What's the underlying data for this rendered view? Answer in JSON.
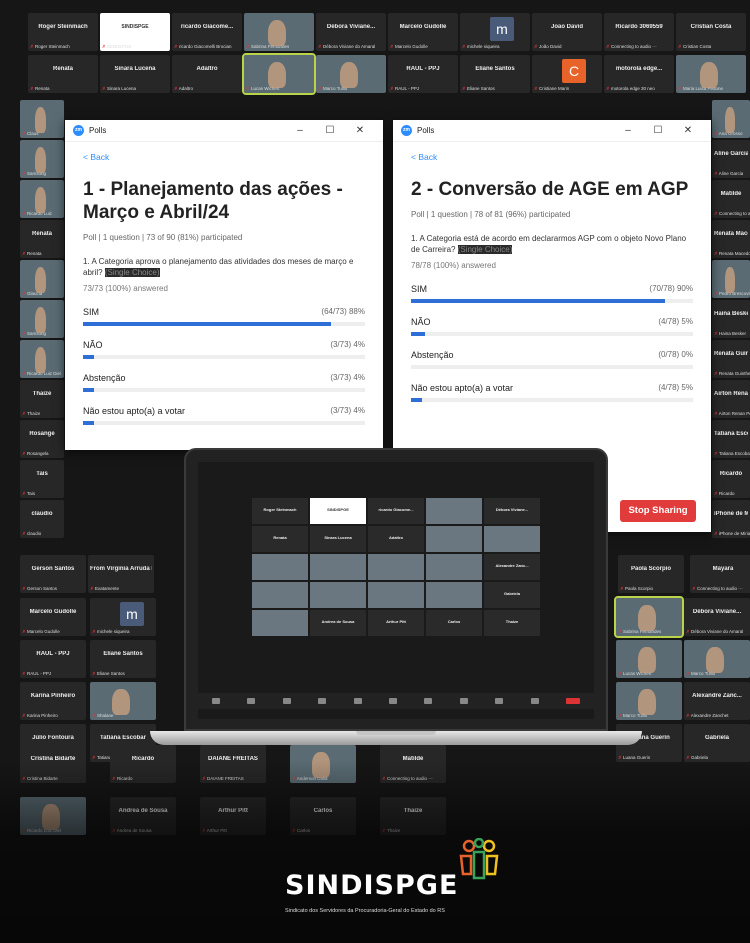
{
  "background": {
    "row1": [
      {
        "name": "Roger Steinmach",
        "label": "Roger Steinmach"
      },
      {
        "name": "SINDISPGE",
        "label": "SINDISPGE",
        "logo": true
      },
      {
        "name": "ricardo Giacome...",
        "label": "ricardo Giacomelli Brocian"
      },
      {
        "name": "",
        "label": "Sabrina Fernandes",
        "photo": true
      },
      {
        "name": "Débora Viviane...",
        "label": "Débora Viviane do Amaral"
      },
      {
        "name": "Marcelo Gudolle",
        "label": "Marcelo Gudolle"
      },
      {
        "name": "",
        "label": "michele siqueira",
        "avatar": "m"
      },
      {
        "name": "João David",
        "label": "João David"
      },
      {
        "name": "Ricardo 3069559",
        "label": "Connecting to audio ···"
      },
      {
        "name": "Cristian Costa",
        "label": "Cristian Costa"
      }
    ],
    "row2": [
      {
        "name": "Renata",
        "label": "Renata"
      },
      {
        "name": "Sinara Lucena",
        "label": "Sinara Lucena"
      },
      {
        "name": "Adaltro",
        "label": "Adaltro"
      },
      {
        "name": "",
        "label": "Lucas Wichert",
        "photo": true,
        "hl": true
      },
      {
        "name": "",
        "label": "Marco Tullio",
        "photo": true
      },
      {
        "name": "RAUL - PPJ",
        "label": "RAUL - PPJ"
      },
      {
        "name": "Eliane Santos",
        "label": "Eliane Santos"
      },
      {
        "name": "",
        "label": "Cristiane Marin",
        "avatarC": "C"
      },
      {
        "name": "motorola edge...",
        "label": "motorola edge 30 neo"
      },
      {
        "name": "",
        "label": "Maria Luisa Pedone",
        "photo": true
      }
    ],
    "left_col": [
      {
        "name": "",
        "label": "Claus",
        "photo": true
      },
      {
        "name": "",
        "label": "Samsung",
        "photo": true
      },
      {
        "name": "",
        "label": "Ricardo Luiz",
        "photo": true
      },
      {
        "name": "Renata",
        "label": "Renata"
      },
      {
        "name": "",
        "label": "Glaucia",
        "photo": true
      },
      {
        "name": "",
        "label": "Samsung",
        "photo": true
      },
      {
        "name": "",
        "label": "Ricardo Luiz Diel",
        "photo": true
      },
      {
        "name": "Thaize",
        "label": "Thaize"
      },
      {
        "name": "Rosange",
        "label": "Rosangela"
      },
      {
        "name": "Tais",
        "label": "Tais"
      },
      {
        "name": "claudio",
        "label": "claudio"
      }
    ],
    "right_col": [
      {
        "name": "",
        "label": "Ana Grosso",
        "photo": true
      },
      {
        "name": "Aline Garcia",
        "label": "Aline Garcia"
      },
      {
        "name": "Matilde",
        "label": "Connecting to audio ···"
      },
      {
        "name": "Renata Macedo",
        "label": "Renata Macedo"
      },
      {
        "name": "",
        "label": "Pedro Brescovit",
        "photo": true
      },
      {
        "name": "Haina Besker",
        "label": "Haina Besker"
      },
      {
        "name": "Renata Guinther",
        "label": "Renata Guinther"
      },
      {
        "name": "Airton Renan P",
        "label": "Airton Renan Pelz"
      },
      {
        "name": "Tatiana Escobar",
        "label": "Tatiana Escobar"
      },
      {
        "name": "Ricardo",
        "label": "Ricardo"
      },
      {
        "name": "iPhone de Miriam",
        "label": "iPhone de Miriam"
      }
    ],
    "row_mid": [
      {
        "name": "Gerson Santos",
        "label": "Gerson Santos"
      },
      {
        "name": "From Virginia Arruda Ebeling to Everyone",
        "label": "Exatamente"
      },
      {
        "name": "",
        "label": "Lucia Bedocchi",
        "photo": true
      },
      {
        "name": "Paola Scorpio",
        "label": "Paola Scorpio"
      },
      {
        "name": "Mayara",
        "label": "Connecting to audio ···"
      }
    ],
    "rows_lower": [
      [
        {
          "name": "Marcelo Gudolle",
          "label": "Marcelo Gudolle"
        },
        {
          "name": "",
          "label": "michele siqueira",
          "avatar": "m"
        },
        {
          "name": "",
          "label": "Sabrina Fernandes",
          "photo": true,
          "hl": true
        },
        {
          "name": "Débora Viviane...",
          "label": "Débora Viviane do Amaral"
        }
      ],
      [
        {
          "name": "RAUL - PPJ",
          "label": "RAUL - PPJ"
        },
        {
          "name": "Eliane Santos",
          "label": "Eliane Santos"
        },
        {
          "name": "",
          "label": "Lucas Wichert",
          "photo": true
        },
        {
          "name": "",
          "label": "Marco Tullio",
          "photo": true
        }
      ],
      [
        {
          "name": "Karina Pinheiro",
          "label": "Karina Pinheiro"
        },
        {
          "name": "",
          "label": "Shalane",
          "photo": true
        },
        {
          "name": "",
          "label": "Marco Tullio",
          "photo": true
        },
        {
          "name": "Alexandre Zanc...",
          "label": "Alexandre Zanchet"
        }
      ],
      [
        {
          "name": "Júlio Fontoura",
          "label": "Júlio Fontoura"
        },
        {
          "name": "Tatiana Escobar",
          "label": "Tatiana Escobar"
        },
        {
          "name": "Tatiana Guerin",
          "label": "Luana Guerin"
        },
        {
          "name": "Gabriela",
          "label": "Gabriela"
        }
      ],
      [
        {
          "name": "Cristina Bidarte",
          "label": "Cristina Bidarte"
        },
        {
          "name": "Ricardo",
          "label": "Ricardo"
        },
        {
          "name": "DAIANE FREITAS",
          "label": "DAIANE FREITAS"
        },
        {
          "name": "",
          "label": "Anderson Dalla",
          "photo": true
        },
        {
          "name": "Matilde",
          "label": "Connecting to audio ···"
        }
      ],
      [
        {
          "name": "",
          "label": "Ricardo Luiz Diel",
          "photo": true
        },
        {
          "name": "Andrea de Sousa",
          "label": "Andrea de Sousa"
        },
        {
          "name": "Arthur Pitt",
          "label": "Arthur Pitt"
        },
        {
          "name": "Carlos",
          "label": "Carlos"
        },
        {
          "name": "Thaize",
          "label": "Thaize"
        }
      ]
    ]
  },
  "poll1": {
    "window_title": "Polls",
    "back": "< Back",
    "title": "1 - Planejamento das ações - Março e Abril/24",
    "meta": "Poll | 1 question | 73 of 90 (81%) participated",
    "question": "1. A Categoria aprova o planejamento das atividades dos meses de março e abril?",
    "qtype": "(Single Choice)",
    "answered": "73/73 (100%) answered",
    "options": [
      {
        "label": "SIM",
        "count": "(64/73) 88%",
        "pct": 88
      },
      {
        "label": "NÃO",
        "count": "(3/73) 4%",
        "pct": 4
      },
      {
        "label": "Abstenção",
        "count": "(3/73) 4%",
        "pct": 4
      },
      {
        "label": "Não estou apto(a) a votar",
        "count": "(3/73) 4%",
        "pct": 4
      }
    ]
  },
  "poll2": {
    "window_title": "Polls",
    "back": "< Back",
    "title": "2 - Conversão de AGE em AGP",
    "meta": "Poll | 1 question | 78 of 81 (96%) participated",
    "question": "1. A Categoria está de acordo em declararmos AGP com o objeto Novo Plano de Carreira?",
    "qtype": "(Single Choice)",
    "answered": "78/78 (100%) answered",
    "options": [
      {
        "label": "SIM",
        "count": "(70/78) 90%",
        "pct": 90
      },
      {
        "label": "NÃO",
        "count": "(4/78) 5%",
        "pct": 5
      },
      {
        "label": "Abstenção",
        "count": "(0/78) 0%",
        "pct": 0
      },
      {
        "label": "Não estou apto(a) a votar",
        "count": "(4/78) 5%",
        "pct": 4
      }
    ]
  },
  "stop_sharing": "Stop Sharing",
  "window_controls": {
    "min": "–",
    "max": "☐",
    "close": "✕"
  },
  "laptop_tiles": [
    {
      "name": "Roger Steinmach"
    },
    {
      "name": "SINDISPGE",
      "w": true
    },
    {
      "name": "ricardo Giacome..."
    },
    {
      "name": "",
      "p": true
    },
    {
      "name": "Débora Viviane..."
    },
    {
      "name": "Renata"
    },
    {
      "name": "Sinara Lucena"
    },
    {
      "name": "Adaltro"
    },
    {
      "name": "",
      "p": true
    },
    {
      "name": "",
      "p": true
    },
    {
      "name": "",
      "p": true
    },
    {
      "name": "",
      "p": true
    },
    {
      "name": "",
      "p": true
    },
    {
      "name": "",
      "p": true
    },
    {
      "name": "Alexandre Zanc..."
    },
    {
      "name": "",
      "p": true
    },
    {
      "name": "",
      "p": true
    },
    {
      "name": "",
      "p": true
    },
    {
      "name": "",
      "p": true
    },
    {
      "name": "Gabriela"
    },
    {
      "name": "",
      "p": true
    },
    {
      "name": "Andrea de Sousa"
    },
    {
      "name": "Arthur Pitt"
    },
    {
      "name": "Carlos"
    },
    {
      "name": "Thaize"
    }
  ],
  "logo": {
    "name": "SINDISPGE",
    "subtitle": "Sindicato dos Servidores da Procuradoria-Geral do Estado do RS"
  },
  "colors": {
    "accent": "#2d8cff",
    "bar": "#2d6fd6",
    "stop": "#e23b3b",
    "highlight": "#b9d34a"
  }
}
